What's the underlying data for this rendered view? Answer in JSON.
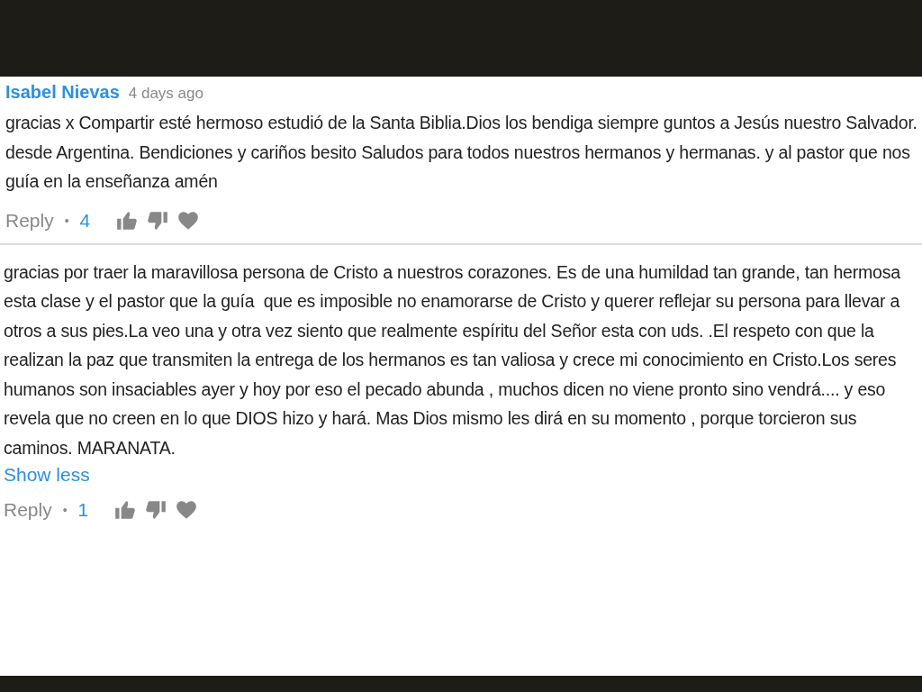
{
  "comments": [
    {
      "author": "Isabel Nievas",
      "time": "4 days ago",
      "text": "gracias x Compartir esté hermoso estudió de la Santa Biblia.Dios los bendiga siempre guntos a Jesús nuestro Salvador. desde Argentina. Bendiciones y cariños besito Saludos para todos nuestros hermanos y hermanas. y al pastor que nos guía en la enseñanza amén",
      "reply": "Reply",
      "separator": "•",
      "likes": "4"
    },
    {
      "text": "gracias por traer la maravillosa persona de Cristo a nuestros corazones. Es de una humildad tan grande, tan hermosa esta clase y el pastor que la guía  que es imposible no enamorarse de Cristo y querer reflejar su persona para llevar a otros a sus pies.La veo una y otra vez siento que realmente espíritu del Señor esta con uds. .El respeto con que la realizan la paz que transmiten la entrega de los hermanos es tan valiosa y crece mi conocimiento en Cristo.Los seres humanos son insaciables ayer y hoy por eso el pecado abunda , muchos dicen no viene pronto sino vendrá.... y eso revela que no creen en lo que DIOS hizo y hará. Mas Dios mismo les dirá en su momento , porque torcieron sus caminos. MARANATA.",
      "toggle": "Show less",
      "reply": "Reply",
      "separator": "•",
      "likes": "1"
    }
  ]
}
